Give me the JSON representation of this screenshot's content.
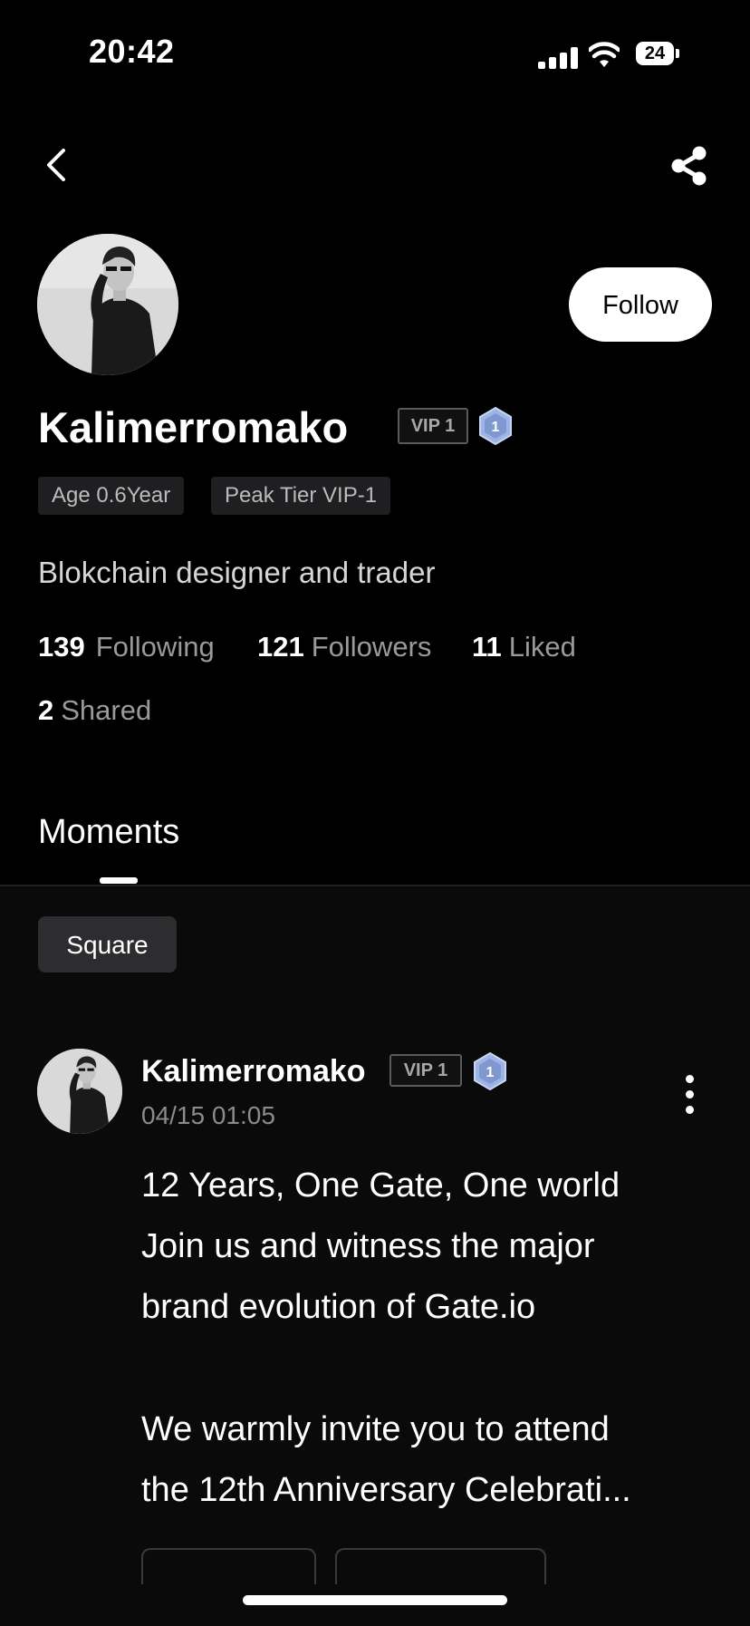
{
  "status_bar": {
    "time": "20:42",
    "battery": "24"
  },
  "profile": {
    "name": "Kalimerromako",
    "vip": "VIP 1",
    "tier_level": "1",
    "follow_label": "Follow",
    "chips": {
      "age": "Age 0.6Year",
      "peak": "Peak Tier VIP-1"
    },
    "bio": "Blokchain designer and trader",
    "stats": {
      "following_count": "139",
      "following_label": "Following",
      "followers_count": "121",
      "followers_label": "Followers",
      "liked_count": "11",
      "liked_label": "Liked",
      "shared_count": "2",
      "shared_label": "Shared"
    }
  },
  "tabs": {
    "moments": "Moments"
  },
  "filter": {
    "square": "Square"
  },
  "post": {
    "author": "Kalimerromako",
    "vip": "VIP 1",
    "tier_level": "1",
    "time": "04/15 01:05",
    "lines": [
      "12 Years, One Gate, One world",
      "Join us and witness the major",
      "brand evolution of Gate.io",
      "We warmly invite you to attend",
      "the 12th Anniversary Celebrati..."
    ]
  },
  "colors": {
    "background": "#000000",
    "chip_bg": "#1f1f21",
    "muted_text": "#9a9a9a",
    "tier_badge": "#9db4e6"
  }
}
